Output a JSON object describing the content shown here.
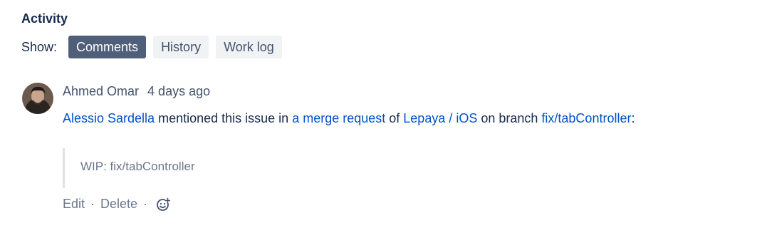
{
  "activity": {
    "title": "Activity",
    "show_label": "Show:",
    "tabs": [
      {
        "label": "Comments",
        "active": true
      },
      {
        "label": "History",
        "active": false
      },
      {
        "label": "Work log",
        "active": false
      }
    ]
  },
  "comment": {
    "author": "Ahmed Omar",
    "timestamp": "4 days ago",
    "body": {
      "mention_user": "Alessio Sardella",
      "text1": " mentioned this issue in ",
      "merge_request_link": "a merge request",
      "text2": " of ",
      "project_link": "Lepaya / iOS",
      "text3": " on branch ",
      "branch_link": "fix/tabController",
      "text4": ":"
    },
    "quote": "WIP: fix/tabController",
    "actions": {
      "edit": "Edit",
      "separator": "·",
      "delete": "Delete"
    }
  },
  "colors": {
    "link": "#0052cc",
    "active_tab_bg": "#505f79",
    "tab_bg": "#f1f2f4",
    "muted_text": "#6b778c"
  },
  "icons": {
    "reaction": "add-reaction-icon"
  }
}
